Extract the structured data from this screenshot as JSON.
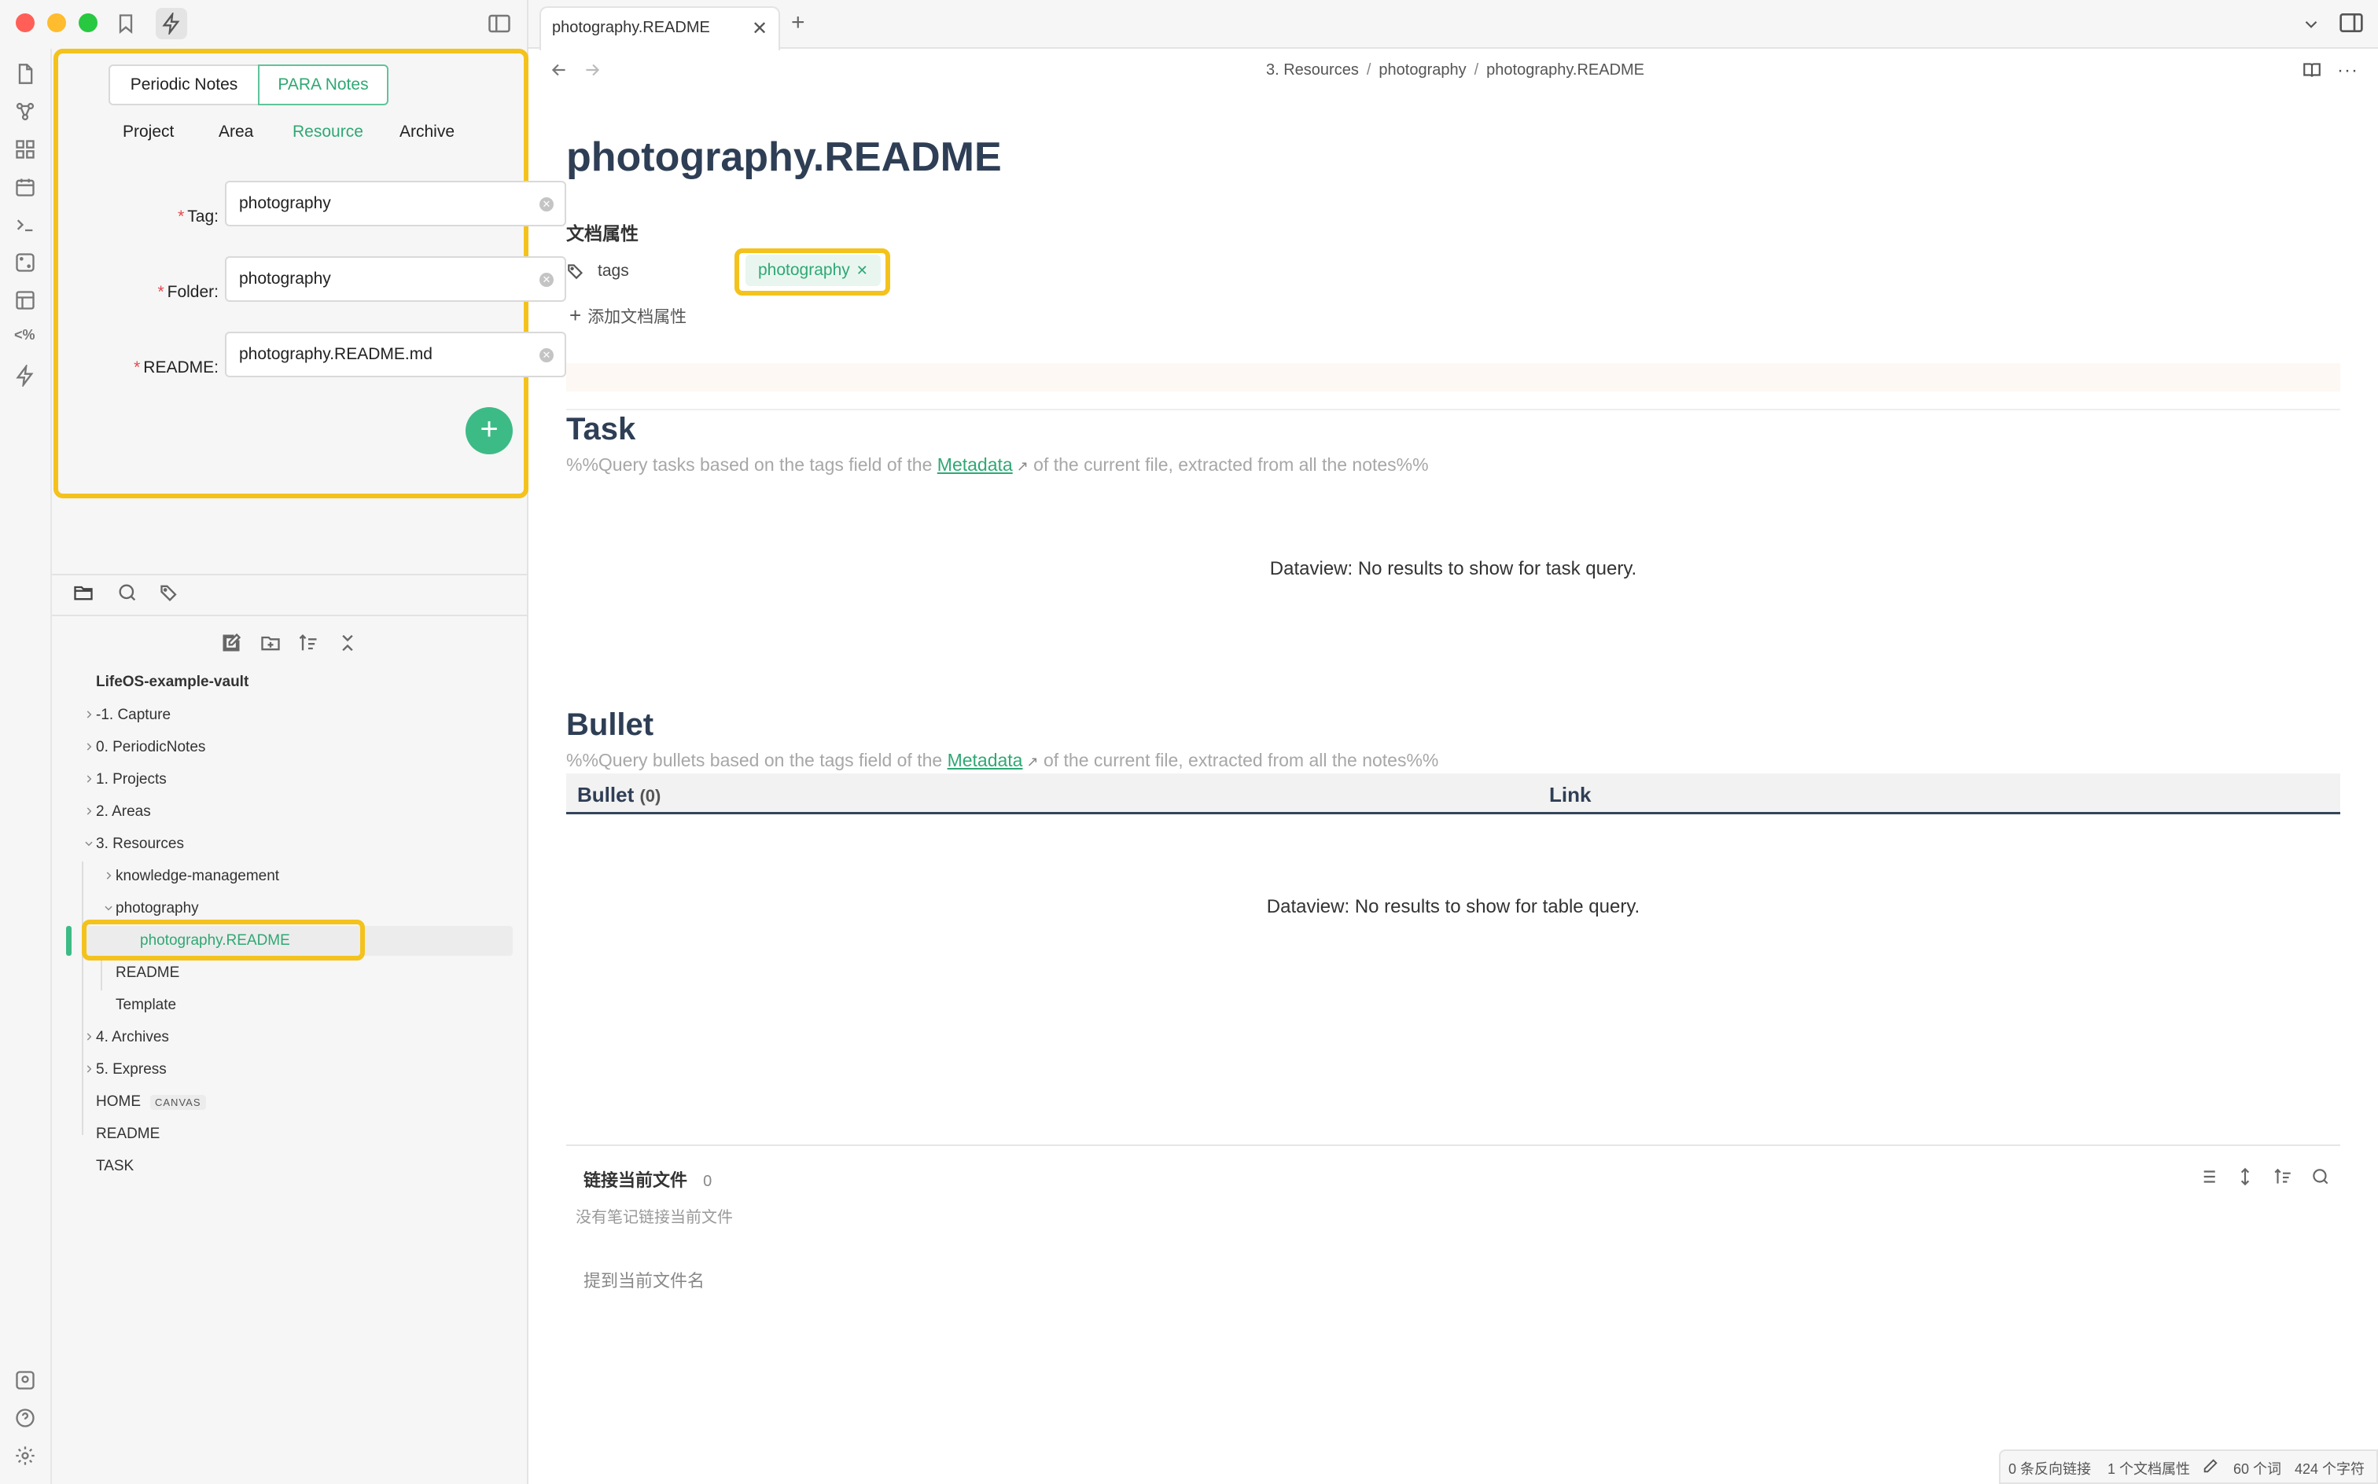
{
  "window": {
    "tab_title": "photography.README",
    "breadcrumb": [
      "3. Resources",
      "photography",
      "photography.README"
    ],
    "breadcrumb_sep": "/"
  },
  "para_panel": {
    "modes": [
      "Periodic Notes",
      "PARA Notes"
    ],
    "active_mode": "PARA Notes",
    "tabs": [
      "Project",
      "Area",
      "Resource",
      "Archive"
    ],
    "active_tab": "Resource",
    "fields": [
      {
        "label": "Tag",
        "value": "photography"
      },
      {
        "label": "Folder",
        "value": "photography"
      },
      {
        "label": "README",
        "value": "photography.README.md"
      }
    ],
    "label_colon": ":",
    "required_mark": "*",
    "add_label": "+"
  },
  "file_tree": {
    "vault_name": "LifeOS-example-vault",
    "items": [
      {
        "label": "-1. Capture",
        "expanded": false
      },
      {
        "label": "0. PeriodicNotes",
        "expanded": false
      },
      {
        "label": "1. Projects",
        "expanded": false
      },
      {
        "label": "2. Areas",
        "expanded": false
      },
      {
        "label": "3. Resources",
        "expanded": true
      },
      {
        "label": "knowledge-management",
        "expanded": false
      },
      {
        "label": "photography",
        "expanded": true
      },
      {
        "label": "photography.README",
        "active": true
      },
      {
        "label": "README"
      },
      {
        "label": "Template"
      },
      {
        "label": "4. Archives",
        "expanded": false
      },
      {
        "label": "5. Express",
        "expanded": false
      },
      {
        "label": "HOME",
        "badge": "CANVAS"
      },
      {
        "label": "README"
      },
      {
        "label": "TASK"
      }
    ]
  },
  "note": {
    "title": "photography.README",
    "properties_heading": "文档属性",
    "property_key": "tags",
    "property_value": "photography",
    "add_property": "添加文档属性",
    "task_heading": "Task",
    "task_comment_before": "%%Query tasks based on the tags field of the ",
    "task_comment_link": "Metadata",
    "task_comment_after": " of the current file, extracted from all the notes%%",
    "task_result": "Dataview: No results to show for task query.",
    "bullet_heading": "Bullet",
    "bullet_comment_before": "%%Query bullets based on the tags field of the ",
    "bullet_comment_link": "Metadata",
    "bullet_comment_after": " of the current file, extracted from all the notes%%",
    "table_col1": "Bullet",
    "table_col1_count": "(0)",
    "table_col2": "Link",
    "table_result": "Dataview: No results to show for table query."
  },
  "backlinks": {
    "heading": "链接当前文件",
    "count": "0",
    "empty": "没有笔记链接当前文件",
    "mentions": "提到当前文件名"
  },
  "status_bar": {
    "backlinks": "0 条反向链接",
    "properties": "1 个文档属性",
    "words": "60 个词",
    "chars": "424 个字符"
  },
  "colors": {
    "accent_green": "#2fa874",
    "highlight_yellow": "#f4c21c",
    "heading": "#2e3e55"
  }
}
